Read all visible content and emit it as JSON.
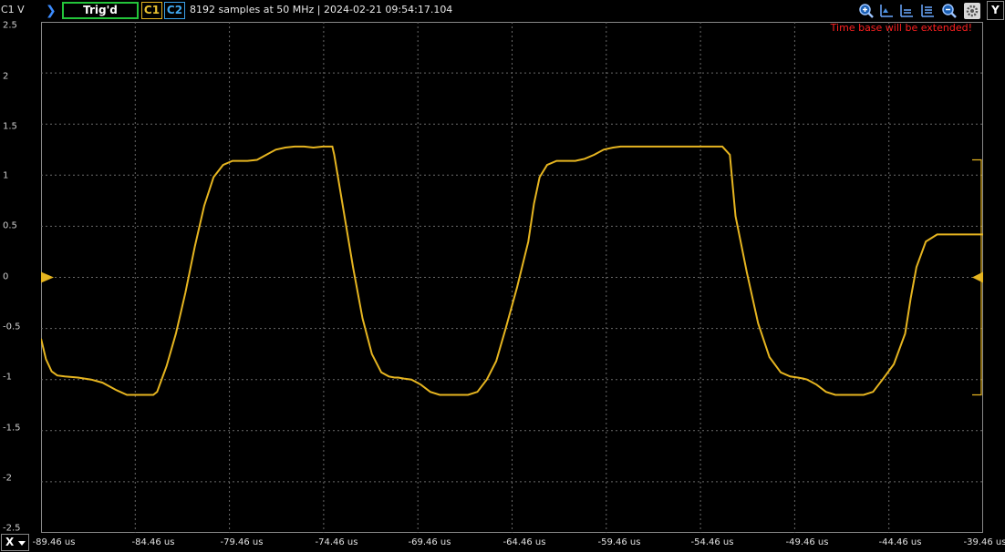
{
  "header": {
    "channel_unit_label": "C1 V",
    "trigger_status": "Trig'd",
    "ch1_label": "C1",
    "ch2_label": "C2",
    "acquisition_info": "8192 samples at 50 MHz | 2024-02-21 09:54:17.104",
    "y_button": "Y",
    "notice": "Time base will be extended!"
  },
  "toolbar": {
    "icons": [
      "zoom-in-icon",
      "cursor-a-icon",
      "cursor-b-icon",
      "cursor-c-icon",
      "zoom-out-icon",
      "settings-icon"
    ]
  },
  "x_axis": {
    "button_label": "X",
    "tick_labels": [
      "-89.46 us",
      "-84.46 us",
      "-79.46 us",
      "-74.46 us",
      "-69.46 us",
      "-64.46 us",
      "-59.46 us",
      "-54.46 us",
      "-49.46 us",
      "-44.46 us",
      "-39.46 us"
    ]
  },
  "y_axis": {
    "tick_labels": [
      "2.5",
      "2",
      "1.5",
      "1",
      "0.5",
      "0",
      "-0.5",
      "-1",
      "-1.5",
      "-2",
      "-2.5"
    ]
  },
  "colors": {
    "trace": "#e6b520",
    "grid": "#6a6a6a",
    "trig_border": "#23c43a",
    "ch1": "#e0b020",
    "ch2": "#3aa0e8",
    "notice": "#ff2020"
  },
  "chart_data": {
    "type": "line",
    "title": "",
    "xlabel": "",
    "ylabel": "C1 V",
    "xlim": [
      -89.46,
      -39.46
    ],
    "ylim": [
      -2.5,
      2.5
    ],
    "grid": true,
    "series": [
      {
        "x": [
          -89.46,
          -89.2,
          -88.9,
          -88.6,
          -88.2,
          -87.5,
          -86.8,
          -86.2,
          -85.5,
          -84.9,
          -84.3,
          -83.8,
          -83.5,
          -83.3,
          -83.1,
          -82.8,
          -82.3,
          -81.8,
          -81.3,
          -80.8,
          -80.3,
          -79.8,
          -79.3,
          -78.9,
          -78.5,
          -78.0,
          -77.5,
          -77.0,
          -76.5,
          -76.0,
          -75.5,
          -75.0,
          -74.5,
          -74.0,
          -73.9,
          -73.4,
          -72.9,
          -72.4,
          -71.9,
          -71.4,
          -71.0,
          -70.7,
          -70.5,
          -70.2,
          -69.8,
          -69.3,
          -68.8,
          -68.3,
          -67.8,
          -67.3,
          -66.8,
          -66.3,
          -65.8,
          -65.3,
          -64.8,
          -64.2,
          -63.6,
          -63.3,
          -63.0,
          -62.6,
          -62.1,
          -61.6,
          -61.1,
          -60.6,
          -60.1,
          -59.6,
          -59.1,
          -58.7,
          -58.3,
          -57.8,
          -57.3,
          -56.8,
          -56.3,
          -55.8,
          -55.3,
          -54.8,
          -54.3,
          -53.8,
          -53.3,
          -52.9,
          -52.6,
          -52.0,
          -51.4,
          -50.8,
          -50.2,
          -49.7,
          -49.3,
          -49.0,
          -48.8,
          -48.3,
          -47.8,
          -47.3,
          -46.8,
          -46.3,
          -45.8,
          -45.3,
          -44.8,
          -44.2,
          -43.6,
          -43.3,
          -43.0,
          -42.5,
          -41.9,
          -41.3,
          -40.7,
          -40.1,
          -39.6,
          -39.46
        ],
        "y": [
          -0.6,
          -0.8,
          -0.92,
          -0.96,
          -0.97,
          -0.98,
          -1.0,
          -1.03,
          -1.1,
          -1.15,
          -1.15,
          -1.15,
          -1.15,
          -1.12,
          -1.02,
          -0.87,
          -0.55,
          -0.15,
          0.3,
          0.7,
          0.98,
          1.1,
          1.14,
          1.14,
          1.14,
          1.15,
          1.2,
          1.25,
          1.27,
          1.28,
          1.28,
          1.27,
          1.28,
          1.28,
          1.2,
          0.65,
          0.1,
          -0.4,
          -0.75,
          -0.93,
          -0.97,
          -0.98,
          -0.98,
          -0.99,
          -1.0,
          -1.05,
          -1.12,
          -1.15,
          -1.15,
          -1.15,
          -1.15,
          -1.12,
          -1.0,
          -0.82,
          -0.5,
          -0.1,
          0.35,
          0.72,
          0.98,
          1.1,
          1.14,
          1.14,
          1.14,
          1.16,
          1.2,
          1.25,
          1.27,
          1.28,
          1.28,
          1.28,
          1.28,
          1.28,
          1.28,
          1.28,
          1.28,
          1.28,
          1.28,
          1.28,
          1.28,
          1.2,
          0.6,
          0.05,
          -0.45,
          -0.78,
          -0.93,
          -0.97,
          -0.98,
          -0.99,
          -1.0,
          -1.05,
          -1.12,
          -1.15,
          -1.15,
          -1.15,
          -1.15,
          -1.12,
          -1.0,
          -0.85,
          -0.55,
          -0.2,
          0.1,
          0.35,
          0.42,
          0.42,
          0.42,
          0.42,
          0.42,
          0.42
        ]
      }
    ]
  }
}
